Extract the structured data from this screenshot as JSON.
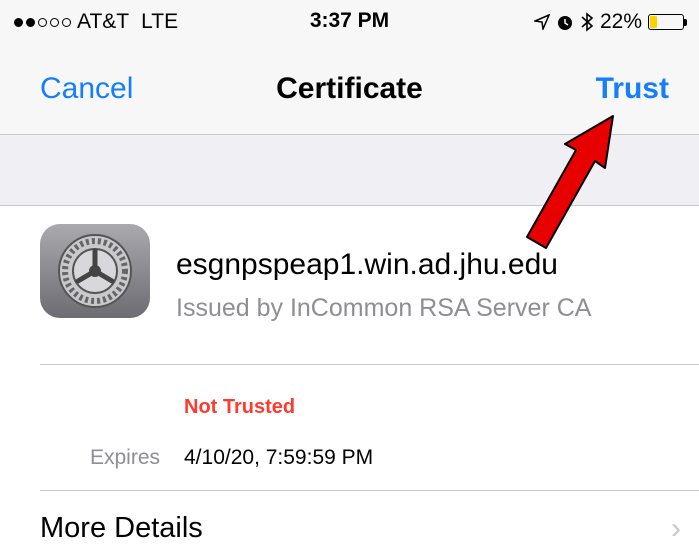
{
  "status_bar": {
    "carrier": "AT&T",
    "network": "LTE",
    "signal_bars": 2,
    "signal_total": 5,
    "time": "3:37 PM",
    "battery_percent": "22%",
    "battery_level": 0.22,
    "battery_color": "#f7d301"
  },
  "nav": {
    "cancel_label": "Cancel",
    "title": "Certificate",
    "trust_label": "Trust",
    "accent_color": "#147efb"
  },
  "certificate": {
    "icon": "settings-gear-icon",
    "name": "esgnpspeap1.win.ad.jhu.edu",
    "issuer": "Issued by InCommon RSA Server CA",
    "trust_status": "Not Trusted",
    "expires_label": "Expires",
    "expires_value": "4/10/20, 7:59:59 PM"
  },
  "more_details": {
    "label": "More Details",
    "chevron": "›"
  },
  "annotation": {
    "type": "red-arrow",
    "color": "#e60000",
    "points_to": "trust-button"
  }
}
